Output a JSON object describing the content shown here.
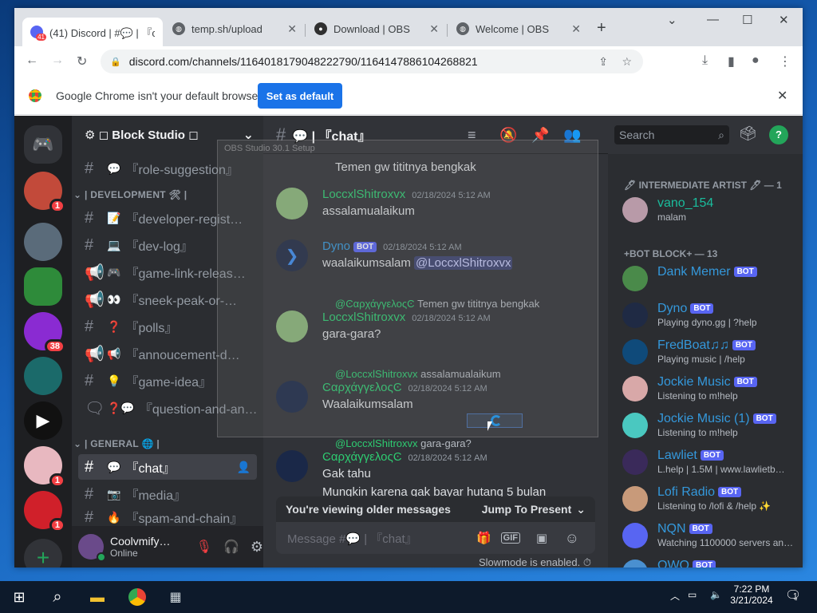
{
  "browser": {
    "tabs": [
      {
        "title": "(41) Discord | #💬 | 『c",
        "icon": "discord-icon"
      },
      {
        "title": "temp.sh/upload",
        "icon": "globe-icon"
      },
      {
        "title": "Download | OBS",
        "icon": "obs-icon"
      },
      {
        "title": "Welcome | OBS",
        "icon": "globe-icon"
      }
    ],
    "tab_badge": "41",
    "new_tab": "+",
    "url": "discord.com/channels/1164018179048222790/1164147886104268821",
    "infobar": {
      "text": "Google Chrome isn't your default browser",
      "button": "Set as default"
    }
  },
  "discord": {
    "servers": [
      {
        "name": "discord-home",
        "badge": ""
      },
      {
        "name": "server-1",
        "badge": "1"
      },
      {
        "name": "server-2",
        "badge": ""
      },
      {
        "name": "server-3",
        "badge": ""
      },
      {
        "name": "server-4",
        "badge": "38"
      },
      {
        "name": "server-5",
        "badge": ""
      },
      {
        "name": "server-6",
        "badge": ""
      },
      {
        "name": "server-7",
        "badge": "1"
      },
      {
        "name": "server-8",
        "badge": "1"
      }
    ],
    "guild_name": "⚙ ◻ Block Studio ◻",
    "channels_top": [
      {
        "emoji": "💬",
        "name": "『role-suggestion』"
      }
    ],
    "category_dev": "| DEVELOPMENT 🛠 |",
    "dev_channels": [
      {
        "emoji": "📝",
        "name": "『developer-regist…"
      },
      {
        "emoji": "💻",
        "name": "『dev-log』"
      },
      {
        "emoji": "🎮",
        "name": "『game-link-releas…"
      },
      {
        "emoji": "👀",
        "name": "『sneek-peak-or-…"
      },
      {
        "emoji": "❓",
        "name": "『polls』"
      },
      {
        "emoji": "📢",
        "name": "『annoucement-d…"
      },
      {
        "emoji": "💡",
        "name": "『game-idea』"
      },
      {
        "emoji": "❓💬",
        "name": "『question-and-an…"
      }
    ],
    "category_general": "| GENERAL 🌐 |",
    "general_channels": [
      {
        "emoji": "💬",
        "name": "『chat』"
      },
      {
        "emoji": "📷",
        "name": "『media』"
      },
      {
        "emoji": "🔥",
        "name": "『spam-and-chain』"
      }
    ],
    "user": {
      "name": "Coolvmify…",
      "status": "Online"
    },
    "chat": {
      "channel": "💬 | 『chat』",
      "search_placeholder": "Search",
      "first_line": "Temen gw tititnya bengkak",
      "messages": [
        {
          "author": "LoccxlShitroxvx",
          "time": "02/18/2024 5:12 AM",
          "text": "assalamualaikum",
          "bot": false
        },
        {
          "author": "Dyno",
          "time": "02/18/2024 5:12 AM",
          "text": "waalaikumsalam ",
          "mention": "@LoccxlShitroxvx",
          "bot": true
        },
        {
          "reply_to": "@ϾαρχάγγελοςϾ",
          "reply_text": "Temen gw tititnya bengkak",
          "author": "LoccxlShitroxvx",
          "time": "02/18/2024 5:12 AM",
          "text": "gara-gara?"
        },
        {
          "reply_to": "@LoccxlShitroxvx",
          "reply_text": "assalamualaikum",
          "author": "ϾαρχάγγελοςϾ",
          "time": "02/18/2024 5:12 AM",
          "text": "Waalaikumsalam"
        },
        {
          "reply_to": "@LoccxlShitroxvx",
          "reply_text": "gara-gara?",
          "author": "ϾαρχάγγελοςϾ",
          "time": "02/18/2024 5:12 AM",
          "text": "Gak tahu",
          "text2": "Mungkin karena gak bayar hutang 5 bulan"
        }
      ],
      "bot_label": "BOT",
      "older_notice": "You're viewing older messages",
      "jump": "Jump To Present",
      "composer_placeholder": "Message #💬 | 『chat』",
      "gif": "GIF",
      "slowmode": "Slowmode is enabled."
    },
    "members": {
      "cat1": "🖊 INTERMEDIATE ARTIST 🖊 — 1",
      "list1": [
        {
          "name": "vano_154",
          "status": "malam",
          "color": "#1abc9c"
        }
      ],
      "cat2": "+BOT BLOCK+ — 13",
      "list2": [
        {
          "name": "Dank Memer",
          "status": "",
          "color": "#3498db"
        },
        {
          "name": "Dyno",
          "status": "Playing dyno.gg | ?help",
          "color": "#3498db"
        },
        {
          "name": "FredBoat♫♫",
          "status": "Playing music | /help",
          "color": "#3498db"
        },
        {
          "name": "Jockie Music",
          "status": "Listening to m!help",
          "color": "#3498db"
        },
        {
          "name": "Jockie Music (1)",
          "status": "Listening to m!help",
          "color": "#3498db"
        },
        {
          "name": "Lawliet",
          "status": "L.help | 1.5M | www.lawlietb…",
          "color": "#3498db"
        },
        {
          "name": "Lofi Radio",
          "status": "Listening to /lofi & /help ✨",
          "color": "#3498db"
        },
        {
          "name": "NQN",
          "status": "Watching 1100000 servers an…",
          "color": "#3498db"
        },
        {
          "name": "OWO",
          "status": "",
          "color": "#3498db"
        }
      ]
    }
  },
  "obs_dialog": {
    "title": "OBS Studio 30.1 Setup"
  },
  "taskbar": {
    "time": "7:22 PM",
    "date": "3/21/2024",
    "notif_count": "1"
  },
  "colors": {
    "discord_bg": "#313338",
    "blurple": "#5865f2",
    "online": "#23a55a",
    "chrome_blue": "#1a73e8"
  }
}
